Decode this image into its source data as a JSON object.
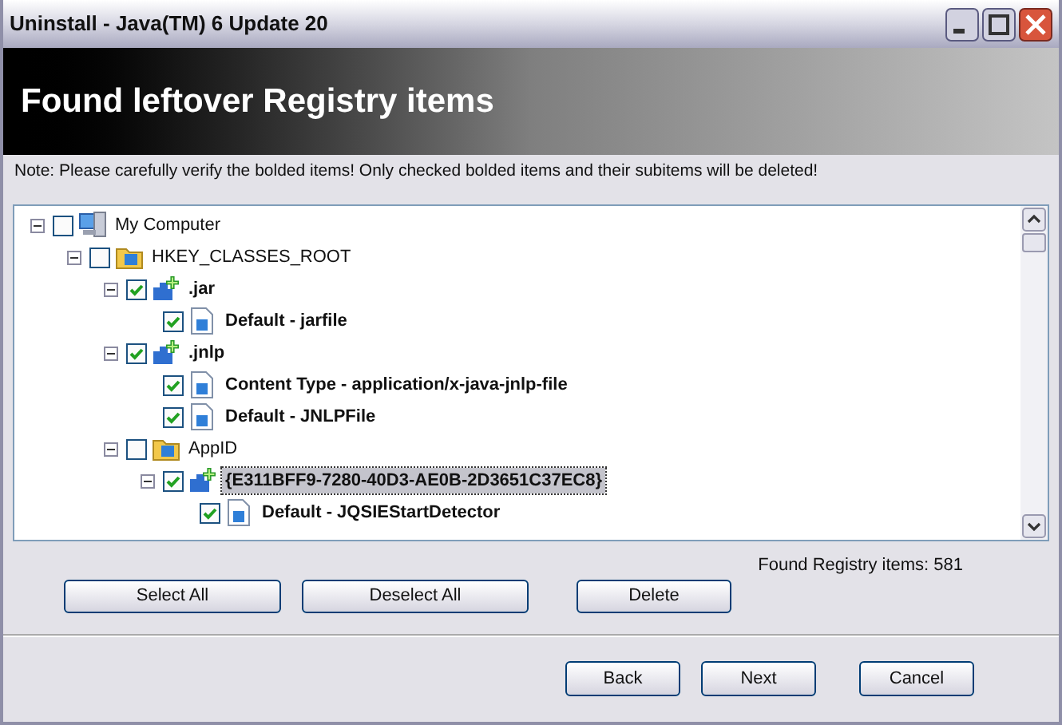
{
  "window": {
    "title": "Uninstall - Java(TM) 6 Update 20"
  },
  "header": {
    "title": "Found leftover Registry items"
  },
  "note": "Note: Please carefully verify the bolded items! Only checked bolded items and their subitems will be deleted!",
  "tree": [
    {
      "label": "My Computer",
      "kind": "computer",
      "bold": false,
      "checked": false,
      "expanded": true,
      "selected": false,
      "children": [
        {
          "label": "HKEY_CLASSES_ROOT",
          "kind": "folder",
          "bold": false,
          "checked": false,
          "expanded": true,
          "selected": false,
          "children": [
            {
              "label": ".jar",
              "kind": "key",
              "bold": true,
              "checked": true,
              "expanded": true,
              "selected": false,
              "children": [
                {
                  "label": "Default - jarfile",
                  "kind": "value",
                  "bold": true,
                  "checked": true,
                  "selected": false
                }
              ]
            },
            {
              "label": ".jnlp",
              "kind": "key",
              "bold": true,
              "checked": true,
              "expanded": true,
              "selected": false,
              "children": [
                {
                  "label": "Content Type - application/x-java-jnlp-file",
                  "kind": "value",
                  "bold": true,
                  "checked": true,
                  "selected": false
                },
                {
                  "label": "Default - JNLPFile",
                  "kind": "value",
                  "bold": true,
                  "checked": true,
                  "selected": false
                }
              ]
            },
            {
              "label": "AppID",
              "kind": "folder",
              "bold": false,
              "checked": false,
              "expanded": true,
              "selected": false,
              "children": [
                {
                  "label": "{E311BFF9-7280-40D3-AE0B-2D3651C37EC8}",
                  "kind": "key",
                  "bold": true,
                  "checked": true,
                  "expanded": true,
                  "selected": true,
                  "children": [
                    {
                      "label": "Default - JQSIEStartDetector",
                      "kind": "value",
                      "bold": true,
                      "checked": true,
                      "selected": false
                    }
                  ]
                }
              ]
            }
          ]
        }
      ]
    }
  ],
  "found": "Found Registry items:  581",
  "actions": [
    "Select All",
    "Deselect All",
    "Delete"
  ],
  "nav": [
    "Back",
    "Next",
    "Cancel"
  ]
}
